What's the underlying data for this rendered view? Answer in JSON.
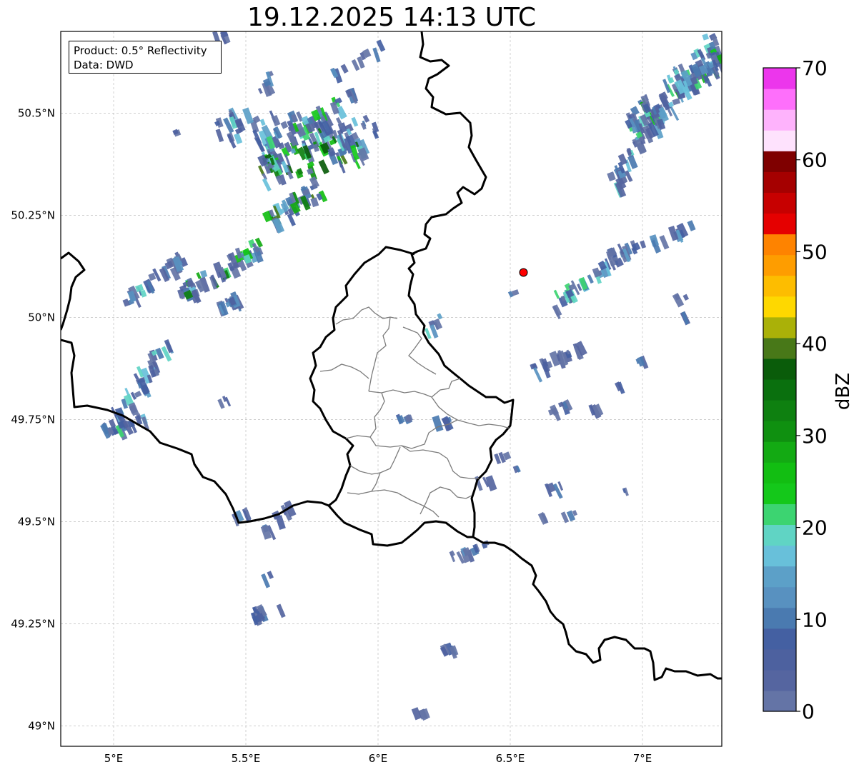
{
  "title": "19.12.2025 14:13 UTC",
  "info": {
    "product": "Product: 0.5° Reflectivity",
    "source": "Data: DWD"
  },
  "map": {
    "lon_range": [
      4.8,
      7.3
    ],
    "lat_range": [
      48.95,
      50.7
    ],
    "x_ticks": [
      {
        "value": 5.0,
        "label": "5°E"
      },
      {
        "value": 5.5,
        "label": "5.5°E"
      },
      {
        "value": 6.0,
        "label": "6°E"
      },
      {
        "value": 6.5,
        "label": "6.5°E"
      },
      {
        "value": 7.0,
        "label": "7°E"
      }
    ],
    "y_ticks": [
      {
        "value": 50.5,
        "label": "50.5°N"
      },
      {
        "value": 50.25,
        "label": "50.25°N"
      },
      {
        "value": 50.0,
        "label": "50°N"
      },
      {
        "value": 49.75,
        "label": "49.75°N"
      },
      {
        "value": 49.5,
        "label": "49.5°N"
      },
      {
        "value": 49.25,
        "label": "49.25°N"
      },
      {
        "value": 49.0,
        "label": "49°N"
      }
    ],
    "grid": true,
    "marker": {
      "lon": 6.55,
      "lat": 50.11,
      "color": "#ff0000"
    }
  },
  "colorbar": {
    "label": "dBZ",
    "min": 0,
    "max": 70,
    "ticks": [
      "0",
      "10",
      "20",
      "30",
      "40",
      "50",
      "60",
      "70"
    ],
    "colors": [
      "#6474a6",
      "#5565a0",
      "#4d619f",
      "#4460a2",
      "#4a7ab0",
      "#5891c0",
      "#5ca0c8",
      "#68c0da",
      "#60d4c4",
      "#3cd471",
      "#14c81a",
      "#12be12",
      "#13aa13",
      "#0f9010",
      "#0e8010",
      "#0a700e",
      "#0a5c0a",
      "#487818",
      "#aab108",
      "#fed800",
      "#fdbd00",
      "#fe9d00",
      "#fe8300",
      "#e50000",
      "#c70000",
      "#a50000",
      "#7f0000",
      "#fee2fd",
      "#feb3fc",
      "#fe6ffb",
      "#ec36ec"
    ]
  }
}
